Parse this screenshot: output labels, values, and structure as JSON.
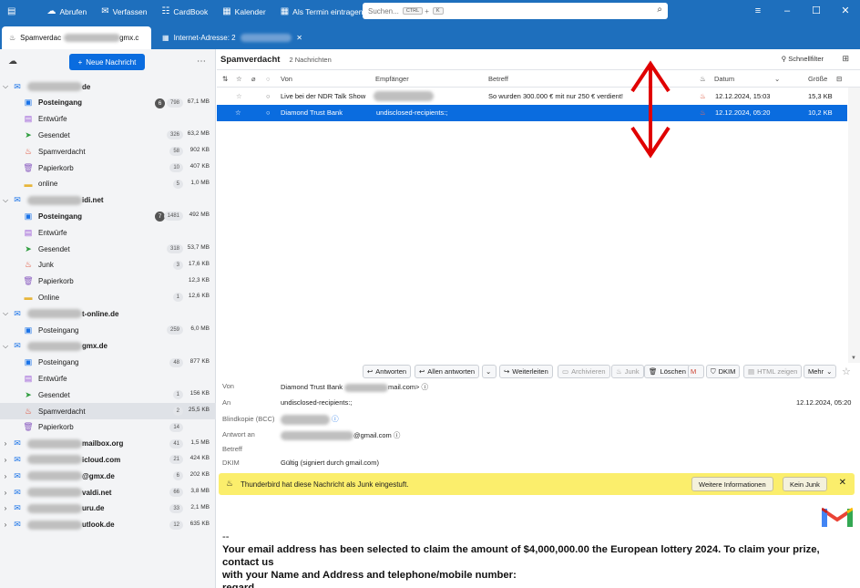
{
  "toolbar": {
    "items": [
      {
        "label": "Abrufen",
        "icon": "fetch-icon"
      },
      {
        "label": "Verfassen",
        "icon": "compose-icon"
      },
      {
        "label": "CardBook",
        "icon": "address-book-icon"
      },
      {
        "label": "Kalender",
        "icon": "calendar-icon"
      },
      {
        "label": "Als Termin eintragen",
        "icon": "calendar-add-icon"
      }
    ],
    "search_placeholder": "Suchen...",
    "search_shortcut_1": "CTRL",
    "search_shortcut_2": "K"
  },
  "tabs": [
    {
      "label": "Spamverdac",
      "tail": "gmx.c",
      "icon": "junk-flame-icon"
    },
    {
      "label": "Internet-Adresse: 2",
      "icon": "calendar-icon"
    }
  ],
  "folder_pane": {
    "new_message_label": "Neue Nachricht",
    "accounts": [
      {
        "name_tail": "de",
        "folders": [
          {
            "name": "Posteingang",
            "bold": true,
            "unread": "6",
            "count": "798",
            "size": "67,1 MB",
            "icon": "inbox-icon"
          },
          {
            "name": "Entwürfe",
            "count": "",
            "size": "",
            "icon": "drafts-icon"
          },
          {
            "name": "Gesendet",
            "count": "326",
            "size": "63,2 MB",
            "icon": "sent-icon"
          },
          {
            "name": "Spamverdacht",
            "count": "58",
            "size": "902 KB",
            "icon": "junk-flame-icon"
          },
          {
            "name": "Papierkorb",
            "count": "10",
            "size": "407 KB",
            "icon": "trash-icon"
          },
          {
            "name": "online",
            "count": "5",
            "size": "1,0 MB",
            "icon": "folder-icon"
          }
        ]
      },
      {
        "name_tail": "idi.net",
        "folders": [
          {
            "name": "Posteingang",
            "bold": true,
            "unread": "7",
            "count": "1481",
            "size": "492 MB",
            "icon": "inbox-icon"
          },
          {
            "name": "Entwürfe",
            "count": "",
            "size": "",
            "icon": "drafts-icon"
          },
          {
            "name": "Gesendet",
            "count": "318",
            "size": "53,7 MB",
            "icon": "sent-icon"
          },
          {
            "name": "Junk",
            "count": "3",
            "size": "17,6 KB",
            "icon": "junk-flame-icon"
          },
          {
            "name": "Papierkorb",
            "count": "",
            "size": "12,3 KB",
            "icon": "trash-icon"
          },
          {
            "name": "Online",
            "count": "1",
            "size": "12,6 KB",
            "icon": "folder-icon"
          }
        ]
      },
      {
        "name_tail": "t-online.de",
        "folders": [
          {
            "name": "Posteingang",
            "count": "259",
            "size": "6,0 MB",
            "icon": "inbox-icon"
          }
        ]
      },
      {
        "name_tail": "gmx.de",
        "folders": [
          {
            "name": "Posteingang",
            "count": "48",
            "size": "877 KB",
            "icon": "inbox-icon"
          },
          {
            "name": "Entwürfe",
            "count": "",
            "size": "",
            "icon": "drafts-icon"
          },
          {
            "name": "Gesendet",
            "count": "1",
            "size": "156 KB",
            "icon": "sent-icon"
          },
          {
            "name": "Spamverdacht",
            "selected": true,
            "count": "2",
            "size": "25,5 KB",
            "icon": "junk-flame-icon"
          },
          {
            "name": "Papierkorb",
            "count": "14",
            "size": "",
            "icon": "trash-icon"
          }
        ]
      },
      {
        "name_tail": "mailbox.org",
        "count": "41",
        "size": "1,5 MB"
      },
      {
        "name_tail": "icloud.com",
        "count": "21",
        "size": "424 KB"
      },
      {
        "name_tail": "@gmx.de",
        "count": "6",
        "size": "202 KB"
      },
      {
        "name_tail": "valdi.net",
        "count": "66",
        "size": "3,8 MB"
      },
      {
        "name_tail": "uru.de",
        "count": "33",
        "size": "2,1 MB"
      },
      {
        "name_tail": "utlook.de",
        "count": "12",
        "size": "635 KB"
      }
    ]
  },
  "thread_pane": {
    "folder_title": "Spamverdacht",
    "message_count": "2 Nachrichten",
    "quick_filter": "Schnellfilter",
    "columns": {
      "from": "Von",
      "recipient": "Empfänger",
      "subject": "Betreff",
      "date": "Datum",
      "size": "Größe"
    },
    "messages": [
      {
        "from": "Live bei der NDR Talk Show",
        "recipient": "",
        "subject": "So wurden 300.000 € mit nur 250 € verdient!",
        "date": "12.12.2024, 15:03",
        "size": "15,3 KB",
        "selected": false
      },
      {
        "from": "Diamond Trust Bank",
        "recipient": "undisclosed-recipients:;",
        "subject": "",
        "date": "12.12.2024, 05:20",
        "size": "10,2 KB",
        "selected": true
      }
    ]
  },
  "message_actions": {
    "reply": "Antworten",
    "reply_all": "Allen antworten",
    "forward": "Weiterleiten",
    "archive": "Archivieren",
    "junk": "Junk",
    "delete": "Löschen",
    "dkim": "DKIM",
    "show_html": "HTML zeigen",
    "more": "Mehr"
  },
  "message_header": {
    "from_label": "Von",
    "from_value": "Diamond Trust Bank",
    "from_tail": "mail.com>",
    "to_label": "An",
    "to_value": "undisclosed-recipients:;",
    "date": "12.12.2024, 05:20",
    "bcc_label": "Blindkopie (BCC)",
    "reply_to_label": "Antwort an",
    "reply_to_tail": "@gmail.com",
    "subject_label": "Betreff",
    "dkim_label": "DKIM",
    "dkim_value": "Gültig (signiert durch gmail.com)"
  },
  "junk_bar": {
    "text": "Thunderbird hat diese Nachricht als Junk eingestuft.",
    "more_info": "Weitere Informationen",
    "not_junk": "Kein Junk"
  },
  "message_body": {
    "line_1": "--",
    "line_2": "Your email address has been selected to claim the amount of $4,000,000.00 the European lottery 2024. To claim your prize, contact us",
    "line_3": "with your Name and Address and telephone/mobile number:",
    "line_4": "regard"
  },
  "colors": {
    "accent": "#1e6fbd",
    "selection": "#0a6cdf",
    "junk_bar": "#fbee6c",
    "annotation": "#e00000"
  }
}
